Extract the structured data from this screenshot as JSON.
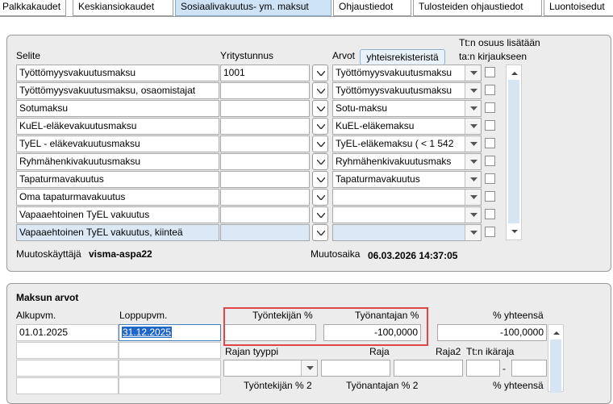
{
  "tabs": [
    {
      "label": "Palkkakaudet"
    },
    {
      "label": "Keskiansiokaudet"
    },
    {
      "label": "Sosiaalivakuutus- ym. maksut"
    },
    {
      "label": "Ohjaustiedot"
    },
    {
      "label": "Tulosteiden ohjaustiedot"
    },
    {
      "label": "Luontoisedut"
    }
  ],
  "table": {
    "col_selite": "Selite",
    "col_yritystunnus": "Yritystunnus",
    "col_arvot": "Arvot",
    "registry_button": "yhteisrekisteristä",
    "col_share_line1": "Tt:n osuus lisätään",
    "col_share_line2": "ta:n kirjaukseen",
    "rows": [
      {
        "selite": "Työttömyysvakuutusmaksu",
        "yritystunnus": "1001",
        "arvo": "Työttömyysvakuutusmaksu"
      },
      {
        "selite": "Työttömyysvakuutusmaksu, osaomistajat",
        "yritystunnus": "",
        "arvo": "Työttömyysvakuutusmaksu"
      },
      {
        "selite": "Sotumaksu",
        "yritystunnus": "",
        "arvo": "Sotu-maksu"
      },
      {
        "selite": "KuEL-eläkevakuutusmaksu",
        "yritystunnus": "",
        "arvo": "KuEL-eläkemaksu"
      },
      {
        "selite": "TyEL - eläkevakuutusmaksu",
        "yritystunnus": "",
        "arvo": "TyEL-eläkemaksu ( < 1 542"
      },
      {
        "selite": "Ryhmähenkivakuutusmaksu",
        "yritystunnus": "",
        "arvo": "Ryhmähenkivakuutusmaks"
      },
      {
        "selite": "Tapaturmavakuutus",
        "yritystunnus": "",
        "arvo": "Tapaturmavakuutus"
      },
      {
        "selite": "Oma tapaturmavakuutus",
        "yritystunnus": "",
        "arvo": ""
      },
      {
        "selite": "Vapaaehtoinen TyEL vakuutus",
        "yritystunnus": "",
        "arvo": ""
      },
      {
        "selite": "Vapaaehtoinen TyEL vakuutus, kiinteä",
        "yritystunnus": "",
        "arvo": ""
      }
    ],
    "modifier_label": "Muutoskäyttäjä",
    "modifier_value": "visma-aspa22",
    "modtime_label": "Muutosaika",
    "modtime_value": "06.03.2026 14:37:05"
  },
  "maksun_arvot": {
    "title": "Maksun arvot",
    "alkupvm_label": "Alkupvm.",
    "loppupvm_label": "Loppupvm.",
    "employee_pct_label": "Työntekijän %",
    "employer_pct_label": "Työnantajan %",
    "total_pct_label": "% yhteensä",
    "alkupvm_value": "01.01.2025",
    "loppupvm_value": "31.12.2025",
    "employee_pct_value": "",
    "employer_pct_value": "-100,0000",
    "total_pct_value": "-100,0000",
    "rajan_tyyppi_label": "Rajan tyyppi",
    "raja_label": "Raja",
    "raja2_label": "Raja2",
    "age_label": "Tt:n ikäraja",
    "age_separator": "-",
    "employee_pct2_label": "Työntekijän % 2",
    "employer_pct2_label": "Työnantajan % 2",
    "total_pct2_label": "% yhteensä"
  },
  "colors": {
    "active_tab": "#cfe3f7",
    "panel_bg": "#ececec",
    "selected_row": "#dbe9f7",
    "highlight_box": "#e04646",
    "scroll_track": "#d7e5f3"
  }
}
